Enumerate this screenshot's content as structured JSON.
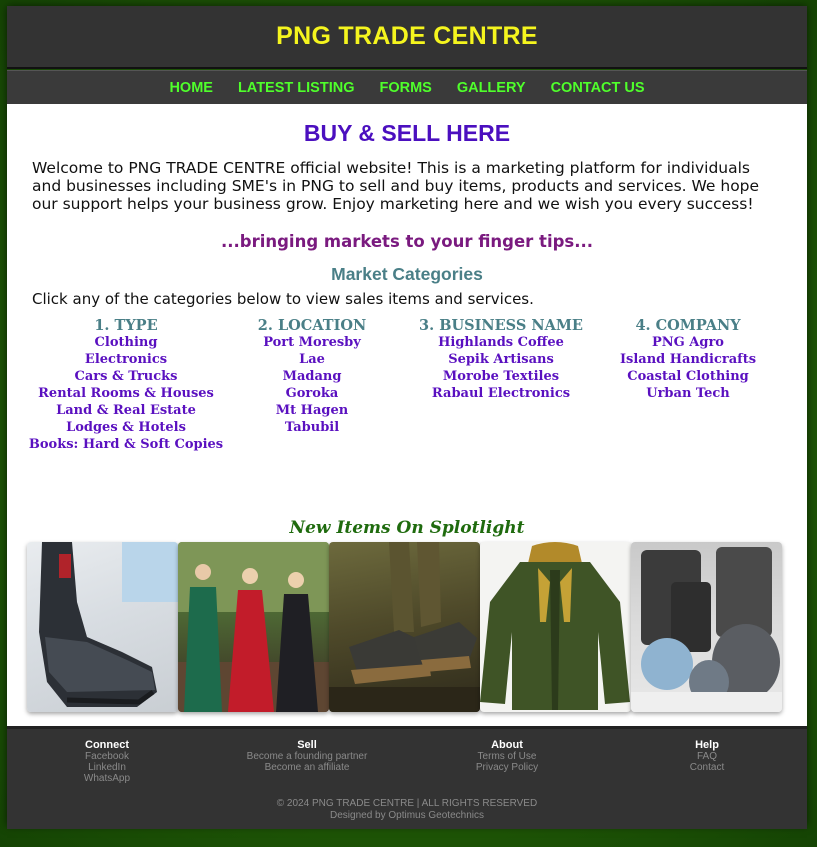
{
  "header": {
    "title": "PNG TRADE CENTRE"
  },
  "nav": [
    "HOME",
    "LATEST LISTING",
    "FORMS",
    "GALLERY",
    "CONTACT US"
  ],
  "main": {
    "heading": "BUY & SELL HERE",
    "intro": "Welcome to PNG TRADE CENTRE official website! This is a marketing platform for individuals and businesses including SME's in PNG to sell and buy items, products and services. We hope our support helps your business grow. Enjoy marketing here and we wish you every success!",
    "tagline": "...bringing markets to your finger tips...",
    "categories_heading": "Market Categories",
    "categories_instruction": "Click any of the categories below to view sales items and services."
  },
  "categories": [
    {
      "title": "1. TYPE",
      "items": [
        "Clothing",
        "Electronics",
        "Cars & Trucks",
        "Rental Rooms & Houses",
        "Land & Real Estate",
        "Lodges & Hotels",
        "Books: Hard & Soft Copies"
      ]
    },
    {
      "title": "2. LOCATION",
      "items": [
        "Port Moresby",
        "Lae",
        "Madang",
        "Goroka",
        "Mt Hagen",
        "Tabubil"
      ]
    },
    {
      "title": "3. BUSINESS NAME",
      "items": [
        "Highlands Coffee",
        "Sepik Artisans",
        "Morobe Textiles",
        "Rabaul Electronics"
      ]
    },
    {
      "title": "4. COMPANY",
      "items": [
        "PNG Agro",
        "Island Handicrafts",
        "Coastal Clothing",
        "Urban Tech"
      ]
    }
  ],
  "spotlight": {
    "title": "New Items On Splotlight"
  },
  "footer": {
    "columns": [
      {
        "heading": "Connect",
        "links": [
          "Facebook",
          "LinkedIn",
          "WhatsApp"
        ]
      },
      {
        "heading": "Sell",
        "links": [
          "Become a founding partner",
          "Become an affiliate"
        ]
      },
      {
        "heading": "About",
        "links": [
          "Terms of Use",
          "Privacy Policy"
        ]
      },
      {
        "heading": "Help",
        "links": [
          "FAQ",
          "Contact"
        ]
      }
    ],
    "copyright": "© 2024 PNG TRADE CENTRE | ALL RIGHTS RESERVED",
    "designer": "Designed by Optimus Geotechnics"
  },
  "colors": {
    "title_yellow": "#f5f51e",
    "nav_green": "#4fff2b",
    "heading_purple": "#4b0fbf",
    "tagline_plum": "#7a1a7f",
    "category_teal": "#4a7f87",
    "link_violet": "#5a10c0",
    "spotlight_green": "#1f6b0e",
    "background_green": "#1d5306"
  }
}
